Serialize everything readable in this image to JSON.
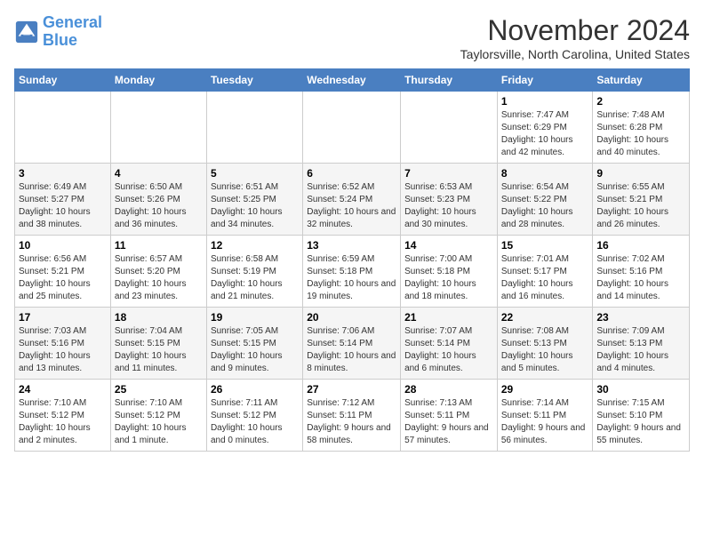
{
  "logo": {
    "line1": "General",
    "line2": "Blue"
  },
  "title": "November 2024",
  "location": "Taylorsville, North Carolina, United States",
  "weekdays": [
    "Sunday",
    "Monday",
    "Tuesday",
    "Wednesday",
    "Thursday",
    "Friday",
    "Saturday"
  ],
  "weeks": [
    [
      {
        "day": "",
        "sunrise": "",
        "sunset": "",
        "daylight": ""
      },
      {
        "day": "",
        "sunrise": "",
        "sunset": "",
        "daylight": ""
      },
      {
        "day": "",
        "sunrise": "",
        "sunset": "",
        "daylight": ""
      },
      {
        "day": "",
        "sunrise": "",
        "sunset": "",
        "daylight": ""
      },
      {
        "day": "",
        "sunrise": "",
        "sunset": "",
        "daylight": ""
      },
      {
        "day": "1",
        "sunrise": "Sunrise: 7:47 AM",
        "sunset": "Sunset: 6:29 PM",
        "daylight": "Daylight: 10 hours and 42 minutes."
      },
      {
        "day": "2",
        "sunrise": "Sunrise: 7:48 AM",
        "sunset": "Sunset: 6:28 PM",
        "daylight": "Daylight: 10 hours and 40 minutes."
      }
    ],
    [
      {
        "day": "3",
        "sunrise": "Sunrise: 6:49 AM",
        "sunset": "Sunset: 5:27 PM",
        "daylight": "Daylight: 10 hours and 38 minutes."
      },
      {
        "day": "4",
        "sunrise": "Sunrise: 6:50 AM",
        "sunset": "Sunset: 5:26 PM",
        "daylight": "Daylight: 10 hours and 36 minutes."
      },
      {
        "day": "5",
        "sunrise": "Sunrise: 6:51 AM",
        "sunset": "Sunset: 5:25 PM",
        "daylight": "Daylight: 10 hours and 34 minutes."
      },
      {
        "day": "6",
        "sunrise": "Sunrise: 6:52 AM",
        "sunset": "Sunset: 5:24 PM",
        "daylight": "Daylight: 10 hours and 32 minutes."
      },
      {
        "day": "7",
        "sunrise": "Sunrise: 6:53 AM",
        "sunset": "Sunset: 5:23 PM",
        "daylight": "Daylight: 10 hours and 30 minutes."
      },
      {
        "day": "8",
        "sunrise": "Sunrise: 6:54 AM",
        "sunset": "Sunset: 5:22 PM",
        "daylight": "Daylight: 10 hours and 28 minutes."
      },
      {
        "day": "9",
        "sunrise": "Sunrise: 6:55 AM",
        "sunset": "Sunset: 5:21 PM",
        "daylight": "Daylight: 10 hours and 26 minutes."
      }
    ],
    [
      {
        "day": "10",
        "sunrise": "Sunrise: 6:56 AM",
        "sunset": "Sunset: 5:21 PM",
        "daylight": "Daylight: 10 hours and 25 minutes."
      },
      {
        "day": "11",
        "sunrise": "Sunrise: 6:57 AM",
        "sunset": "Sunset: 5:20 PM",
        "daylight": "Daylight: 10 hours and 23 minutes."
      },
      {
        "day": "12",
        "sunrise": "Sunrise: 6:58 AM",
        "sunset": "Sunset: 5:19 PM",
        "daylight": "Daylight: 10 hours and 21 minutes."
      },
      {
        "day": "13",
        "sunrise": "Sunrise: 6:59 AM",
        "sunset": "Sunset: 5:18 PM",
        "daylight": "Daylight: 10 hours and 19 minutes."
      },
      {
        "day": "14",
        "sunrise": "Sunrise: 7:00 AM",
        "sunset": "Sunset: 5:18 PM",
        "daylight": "Daylight: 10 hours and 18 minutes."
      },
      {
        "day": "15",
        "sunrise": "Sunrise: 7:01 AM",
        "sunset": "Sunset: 5:17 PM",
        "daylight": "Daylight: 10 hours and 16 minutes."
      },
      {
        "day": "16",
        "sunrise": "Sunrise: 7:02 AM",
        "sunset": "Sunset: 5:16 PM",
        "daylight": "Daylight: 10 hours and 14 minutes."
      }
    ],
    [
      {
        "day": "17",
        "sunrise": "Sunrise: 7:03 AM",
        "sunset": "Sunset: 5:16 PM",
        "daylight": "Daylight: 10 hours and 13 minutes."
      },
      {
        "day": "18",
        "sunrise": "Sunrise: 7:04 AM",
        "sunset": "Sunset: 5:15 PM",
        "daylight": "Daylight: 10 hours and 11 minutes."
      },
      {
        "day": "19",
        "sunrise": "Sunrise: 7:05 AM",
        "sunset": "Sunset: 5:15 PM",
        "daylight": "Daylight: 10 hours and 9 minutes."
      },
      {
        "day": "20",
        "sunrise": "Sunrise: 7:06 AM",
        "sunset": "Sunset: 5:14 PM",
        "daylight": "Daylight: 10 hours and 8 minutes."
      },
      {
        "day": "21",
        "sunrise": "Sunrise: 7:07 AM",
        "sunset": "Sunset: 5:14 PM",
        "daylight": "Daylight: 10 hours and 6 minutes."
      },
      {
        "day": "22",
        "sunrise": "Sunrise: 7:08 AM",
        "sunset": "Sunset: 5:13 PM",
        "daylight": "Daylight: 10 hours and 5 minutes."
      },
      {
        "day": "23",
        "sunrise": "Sunrise: 7:09 AM",
        "sunset": "Sunset: 5:13 PM",
        "daylight": "Daylight: 10 hours and 4 minutes."
      }
    ],
    [
      {
        "day": "24",
        "sunrise": "Sunrise: 7:10 AM",
        "sunset": "Sunset: 5:12 PM",
        "daylight": "Daylight: 10 hours and 2 minutes."
      },
      {
        "day": "25",
        "sunrise": "Sunrise: 7:10 AM",
        "sunset": "Sunset: 5:12 PM",
        "daylight": "Daylight: 10 hours and 1 minute."
      },
      {
        "day": "26",
        "sunrise": "Sunrise: 7:11 AM",
        "sunset": "Sunset: 5:12 PM",
        "daylight": "Daylight: 10 hours and 0 minutes."
      },
      {
        "day": "27",
        "sunrise": "Sunrise: 7:12 AM",
        "sunset": "Sunset: 5:11 PM",
        "daylight": "Daylight: 9 hours and 58 minutes."
      },
      {
        "day": "28",
        "sunrise": "Sunrise: 7:13 AM",
        "sunset": "Sunset: 5:11 PM",
        "daylight": "Daylight: 9 hours and 57 minutes."
      },
      {
        "day": "29",
        "sunrise": "Sunrise: 7:14 AM",
        "sunset": "Sunset: 5:11 PM",
        "daylight": "Daylight: 9 hours and 56 minutes."
      },
      {
        "day": "30",
        "sunrise": "Sunrise: 7:15 AM",
        "sunset": "Sunset: 5:10 PM",
        "daylight": "Daylight: 9 hours and 55 minutes."
      }
    ]
  ]
}
